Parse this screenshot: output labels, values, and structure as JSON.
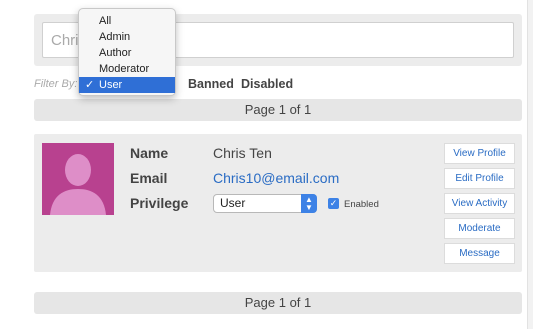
{
  "search": {
    "value": "Chri"
  },
  "filter": {
    "label": "Filter By:",
    "options": [
      "Banned",
      "Disabled"
    ]
  },
  "dropdown": {
    "items": [
      "All",
      "Admin",
      "Author",
      "Moderator",
      "User"
    ],
    "selected": "User",
    "check": "✓"
  },
  "pager": {
    "top": "Page 1 of 1",
    "bottom": "Page 1 of 1"
  },
  "user": {
    "labels": {
      "name": "Name",
      "email": "Email",
      "privilege": "Privilege"
    },
    "name": "Chris Ten",
    "email": "Chris10@email.com",
    "privilege": "User",
    "enabled_label": "Enabled",
    "enabled": true,
    "avatar_color": "#b8418f"
  },
  "actions": [
    "View Profile",
    "Edit Profile",
    "View Activity",
    "Moderate",
    "Message"
  ],
  "colors": {
    "accent": "#2f6fd6",
    "link": "#2a6cc4",
    "panel": "#ececec"
  }
}
